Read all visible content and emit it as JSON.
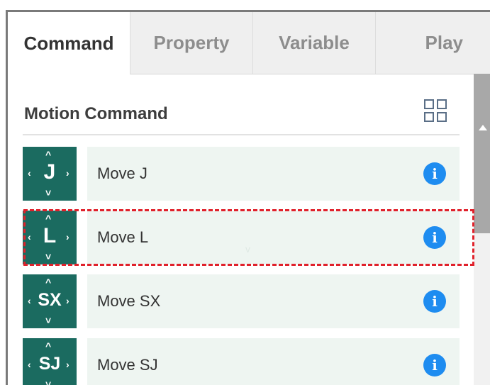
{
  "tabs": [
    {
      "label": "Command",
      "active": true
    },
    {
      "label": "Property",
      "active": false
    },
    {
      "label": "Variable",
      "active": false
    },
    {
      "label": "Play",
      "active": false
    }
  ],
  "section": {
    "title": "Motion Command",
    "view_toggle_icon": "grid-view-icon"
  },
  "commands": [
    {
      "icon_text": "J",
      "label": "Move J",
      "info_icon": "info-icon",
      "info_glyph": "i"
    },
    {
      "icon_text": "L",
      "label": "Move L",
      "info_icon": "info-icon",
      "info_glyph": "i"
    },
    {
      "icon_text": "SX",
      "label": "Move SX",
      "info_icon": "info-icon",
      "info_glyph": "i"
    },
    {
      "icon_text": "SJ",
      "label": "Move SJ",
      "info_icon": "info-icon",
      "info_glyph": "i"
    }
  ],
  "arrows": {
    "up": "^",
    "down": "˅",
    "left": "‹",
    "right": "›"
  },
  "cursor_glyph": "v",
  "colors": {
    "icon_bg": "#1b6b60",
    "row_bg": "#eef5f1",
    "info": "#1e8cf0",
    "highlight": "#e0212b"
  }
}
